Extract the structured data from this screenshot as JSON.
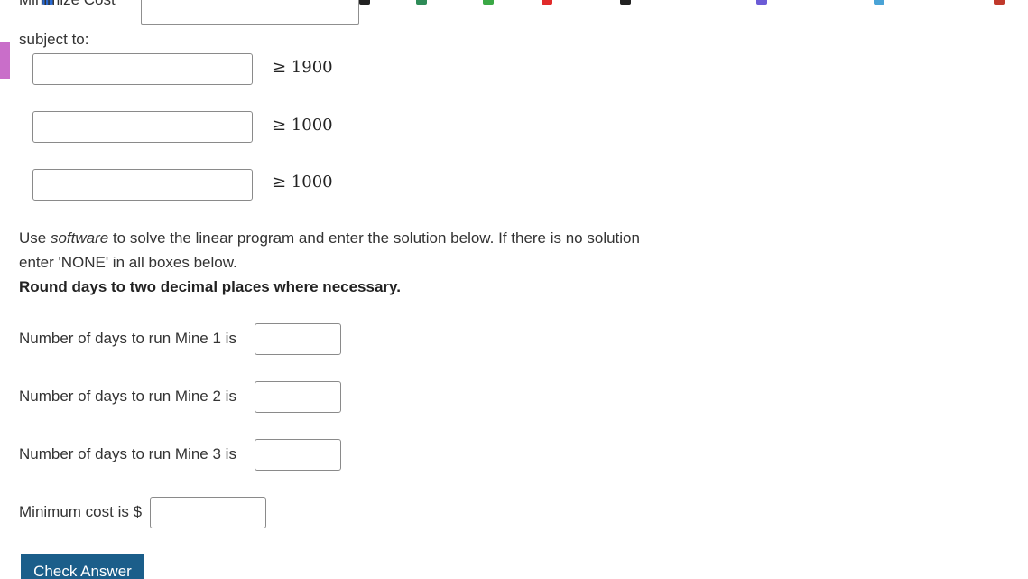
{
  "partial_top": {
    "objective_label": "Minimize Cost"
  },
  "constraints": {
    "subject_label": "subject to:",
    "rows": [
      {
        "rhs": "≥ 1900"
      },
      {
        "rhs": "≥ 1000"
      },
      {
        "rhs": "≥ 1000"
      }
    ]
  },
  "instructions": {
    "line1_prefix": "Use ",
    "line1_em": "software",
    "line1_suffix": " to solve the linear program and enter the solution below. If there is no solution enter 'NONE' in all boxes below.",
    "bold": "Round days to two decimal places where necessary."
  },
  "answers": {
    "mine1_label": "Number of days to run Mine 1 is",
    "mine2_label": "Number of days to run Mine 2 is",
    "mine3_label": "Number of days to run Mine 3 is",
    "cost_label": "Minimum cost is $",
    "mine1_value": "",
    "mine2_value": "",
    "mine3_value": "",
    "cost_value": ""
  },
  "buttons": {
    "check_answer": "Check Answer"
  },
  "colors": {
    "accent_marker": "#c96ec9",
    "button_bg": "#1b5e8a"
  }
}
